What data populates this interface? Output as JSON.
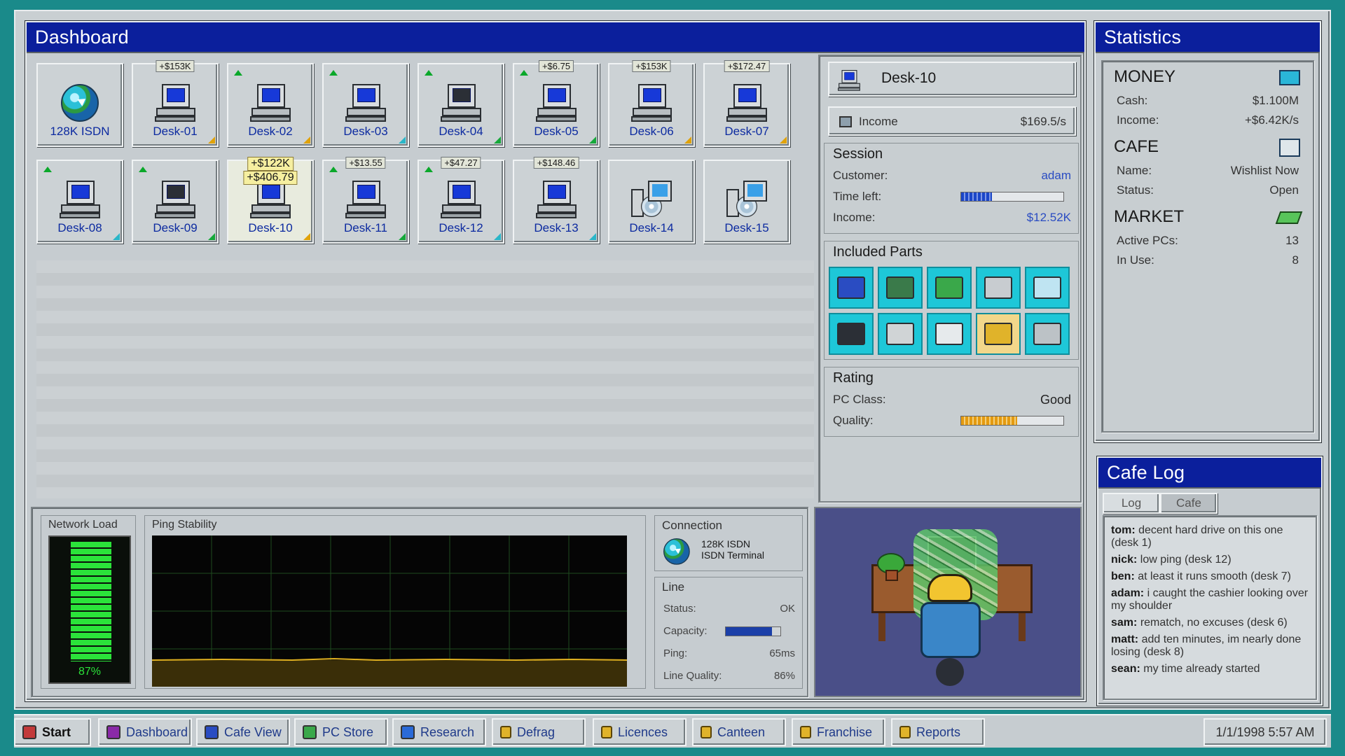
{
  "dashboard": {
    "title": "Dashboard",
    "desks": [
      {
        "label": "128K ISDN",
        "type": "globe",
        "tag": "",
        "up": false,
        "corner": ""
      },
      {
        "label": "Desk-01",
        "type": "pc",
        "tag": "+$153K",
        "up": false,
        "corner": "y"
      },
      {
        "label": "Desk-02",
        "type": "pc",
        "tag": "",
        "up": true,
        "corner": "y"
      },
      {
        "label": "Desk-03",
        "type": "pc",
        "tag": "",
        "up": true,
        "corner": "c"
      },
      {
        "label": "Desk-04",
        "type": "pc-off",
        "tag": "",
        "up": true,
        "corner": "g"
      },
      {
        "label": "Desk-05",
        "type": "pc",
        "tag": "+$6.75",
        "up": true,
        "corner": "g"
      },
      {
        "label": "Desk-06",
        "type": "pc",
        "tag": "+$153K",
        "up": false,
        "corner": "y"
      },
      {
        "label": "Desk-07",
        "type": "pc",
        "tag": "+$172.47",
        "up": false,
        "corner": "y"
      },
      {
        "label": "Desk-08",
        "type": "pc",
        "tag": "",
        "up": true,
        "corner": "c"
      },
      {
        "label": "Desk-09",
        "type": "pc-off",
        "tag": "",
        "up": true,
        "corner": "g"
      },
      {
        "label": "Desk-10",
        "type": "pc",
        "tag": "+$122K",
        "tag2": "+$406.79",
        "up": false,
        "corner": "y",
        "selected": true
      },
      {
        "label": "Desk-11",
        "type": "pc",
        "tag": "+$13.55",
        "up": true,
        "corner": "g"
      },
      {
        "label": "Desk-12",
        "type": "pc",
        "tag": "+$47.27",
        "up": true,
        "corner": "c"
      },
      {
        "label": "Desk-13",
        "type": "pc",
        "tag": "+$148.46",
        "up": false,
        "corner": "c"
      },
      {
        "label": "Desk-14",
        "type": "cd",
        "tag": "",
        "up": false,
        "corner": ""
      },
      {
        "label": "Desk-15",
        "type": "cd",
        "tag": "",
        "up": false,
        "corner": ""
      }
    ]
  },
  "detail": {
    "desk_name": "Desk-10",
    "income_label": "Income",
    "income_value": "$169.5/s",
    "session": {
      "title": "Session",
      "customer_label": "Customer:",
      "customer_value": "adam",
      "time_left_label": "Time left:",
      "time_left_fraction": 0.3,
      "income_label": "Income:",
      "income_value": "$12.52K"
    },
    "parts_title": "Included Parts",
    "parts": [
      "hdd",
      "motherboard",
      "ram",
      "drive",
      "monitor",
      "crt-monitor",
      "keyboard",
      "mouse",
      "speaker",
      "tower"
    ],
    "rating": {
      "title": "Rating",
      "pc_class_label": "PC Class:",
      "pc_class_value": "Good",
      "quality_label": "Quality:",
      "quality_fraction": 0.55
    }
  },
  "network": {
    "load_title": "Network Load",
    "load_percent": "87%",
    "load_fraction": 0.87,
    "ping_title": "Ping Stability",
    "connection_title": "Connection",
    "connection_name": "128K ISDN",
    "connection_sub": "ISDN Terminal",
    "line": {
      "title": "Line",
      "status_label": "Status:",
      "status_value": "OK",
      "capacity_label": "Capacity:",
      "capacity_fraction": 0.85,
      "ping_label": "Ping:",
      "ping_value": "65ms",
      "quality_label": "Line Quality:",
      "quality_value": "86%"
    }
  },
  "statistics": {
    "title": "Statistics",
    "money_title": "MONEY",
    "cash_label": "Cash:",
    "cash_value": "$1.100M",
    "income_label": "Income:",
    "income_value": "+$6.42K/s",
    "cafe_title": "CAFE",
    "name_label": "Name:",
    "name_value": "Wishlist Now",
    "status_label": "Status:",
    "status_value": "Open",
    "market_title": "MARKET",
    "active_label": "Active PCs:",
    "active_value": "13",
    "inuse_label": "In Use:",
    "inuse_value": "8"
  },
  "cafe_log": {
    "title": "Cafe Log",
    "tabs": [
      "Log",
      "Cafe"
    ],
    "entries": [
      {
        "who": "tom:",
        "msg": "decent hard drive on this one (desk 1)"
      },
      {
        "who": "nick:",
        "msg": "low ping (desk 12)"
      },
      {
        "who": "ben:",
        "msg": "at least it runs smooth (desk 7)"
      },
      {
        "who": "adam:",
        "msg": "i caught the cashier looking over my shoulder"
      },
      {
        "who": "sam:",
        "msg": "rematch, no excuses (desk 6)"
      },
      {
        "who": "matt:",
        "msg": "add ten minutes, im nearly done losing (desk 8)"
      },
      {
        "who": "sean:",
        "msg": "my time already started"
      }
    ]
  },
  "taskbar": {
    "start": "Start",
    "buttons": [
      "Dashboard",
      "Cafe View",
      "PC Store",
      "Research",
      "Defrag",
      "Licences",
      "Canteen",
      "Franchise",
      "Reports"
    ],
    "clock": "1/1/1998 5:57 AM"
  },
  "colors": {
    "title_blue": "#0b1f9c",
    "teal": "#1a8a8a",
    "part_cyan": "#1ec7d8"
  }
}
